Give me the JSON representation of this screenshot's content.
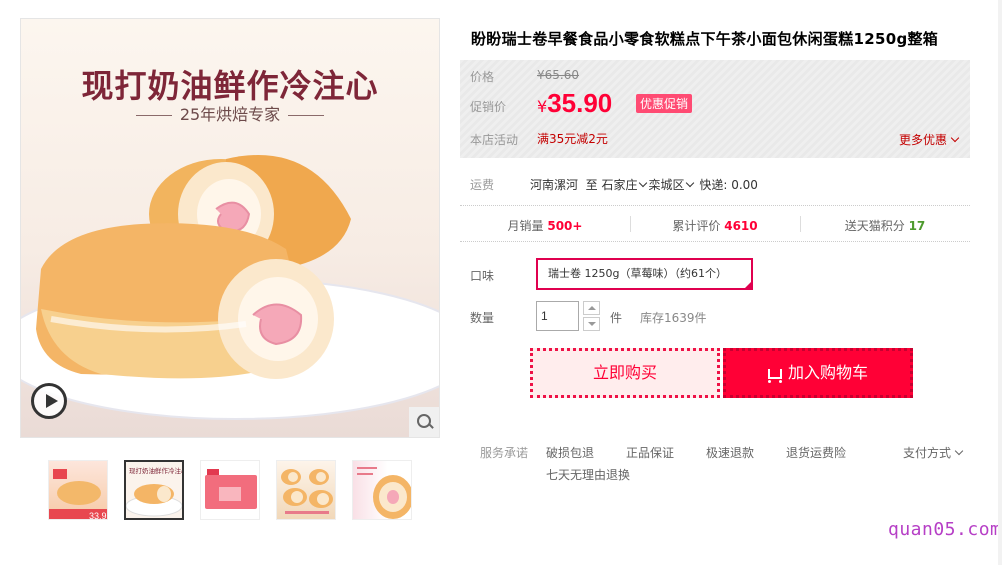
{
  "gallery": {
    "slogan": "现打奶油鲜作冷注心",
    "sub_slogan": "25年烘焙专家",
    "thumbnails": [
      {
        "icon": "thumb-cake-box",
        "caption": "33.9"
      },
      {
        "icon": "thumb-cake-slogan",
        "caption": "现打奶油鲜作冷注心"
      },
      {
        "icon": "thumb-package"
      },
      {
        "icon": "thumb-rolls"
      },
      {
        "icon": "thumb-roll-closeup"
      }
    ],
    "active_thumb": 1
  },
  "product": {
    "title": "盼盼瑞士卷早餐食品小零食软糕点下午茶小面包休闲蛋糕1250g整箱"
  },
  "price": {
    "orig_label": "价格",
    "orig_value": "¥65.60",
    "promo_label": "促销价",
    "currency": "¥",
    "promo_value": "35.90",
    "promo_tag": "优惠促销",
    "activity_label": "本店活动",
    "activity_text": "满35元减2元",
    "more_discount": "更多优惠"
  },
  "shipping": {
    "label": "运费",
    "from": "河南漯河",
    "to_word": "至",
    "city": "石家庄",
    "district": "栾城区",
    "express": "快递: 0.00"
  },
  "stats": {
    "monthly_label": "月销量",
    "monthly_value": "500+",
    "reviews_label": "累计评价",
    "reviews_value": "4610",
    "points_label": "送天猫积分",
    "points_value": "17"
  },
  "options": {
    "flavor_label": "口味",
    "flavor_value": "瑞士卷 1250g（草莓味）（约61个）",
    "qty_label": "数量",
    "qty_value": "1",
    "unit": "件",
    "stock": "库存1639件"
  },
  "actions": {
    "buy_now": "立即购买",
    "add_cart": "加入购物车"
  },
  "service": {
    "label": "服务承诺",
    "items": [
      "破损包退",
      "正品保证",
      "极速退款",
      "退货运费险",
      "七天无理由退换"
    ],
    "payment": "支付方式"
  },
  "watermark": "quan05.com",
  "colors": {
    "brand_red": "#ff0036",
    "slogan": "#7e2638",
    "points_green": "#4e9a2e",
    "watermark": "#b63fc6"
  }
}
